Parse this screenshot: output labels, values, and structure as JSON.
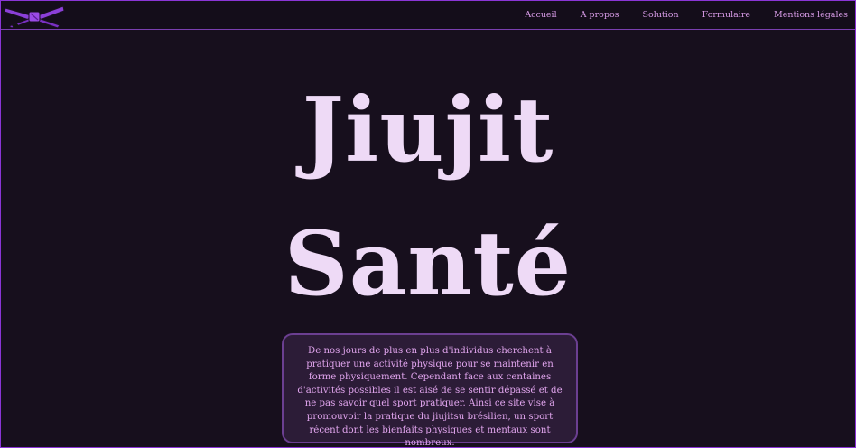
{
  "header": {
    "logo_icon": "belt-knot-icon",
    "nav": [
      {
        "label": "Accueil"
      },
      {
        "label": "A propos"
      },
      {
        "label": "Solution"
      },
      {
        "label": "Formulaire"
      },
      {
        "label": "Mentions légales"
      }
    ]
  },
  "hero": {
    "title_line1": "Jiujit",
    "title_line2": "Santé"
  },
  "intro": {
    "text": "De nos jours de plus en plus d'individus cherchent à pratiquer une activité physique pour se maintenir en forme physiquement. Cependant face aux centaines d'activités possibles il est aisé de se sentir dépassé et de ne pas savoir quel sport pratiquer. Ainsi ce site vise à promouvoir la pratique du jiujitsu brésilien, un sport récent dont les bienfaits physiques et mentaux sont nombreux."
  },
  "colors": {
    "background": "#170f1d",
    "accent": "#8a35d6",
    "nav_text": "#d79be6",
    "title_text": "#eedaf6",
    "box_bg": "#2c1c37"
  }
}
